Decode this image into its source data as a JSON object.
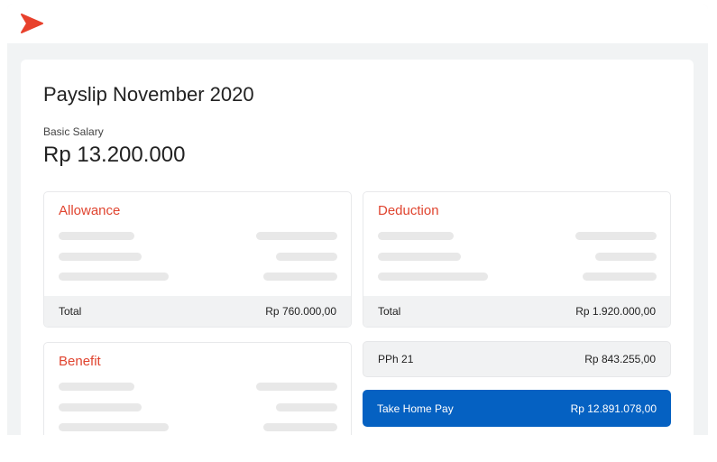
{
  "brand": {
    "logo": "chevron-logo",
    "color": "#e8412c"
  },
  "page": {
    "title": "Payslip November 2020",
    "basic_salary_label": "Basic Salary",
    "basic_salary": "Rp 13.200.000"
  },
  "allowance": {
    "title": "Allowance",
    "total_label": "Total",
    "total": "Rp 760.000,00"
  },
  "deduction": {
    "title": "Deduction",
    "total_label": "Total",
    "total": "Rp 1.920.000,00"
  },
  "benefit": {
    "title": "Benefit"
  },
  "pph": {
    "label": "PPh 21",
    "value": "Rp 843.255,00"
  },
  "take_home": {
    "label": "Take Home Pay",
    "value": "Rp 12.891.078,00",
    "color": "#0561c2"
  }
}
